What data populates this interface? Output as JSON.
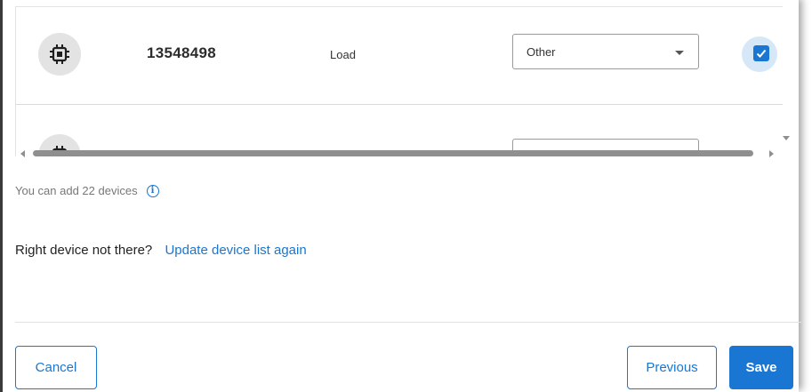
{
  "devices": [
    {
      "id": "13548498",
      "type": "Load",
      "category": "Other",
      "checked": true
    },
    {
      "id": "",
      "type": "",
      "category": "",
      "checked": false
    }
  ],
  "info": {
    "text": "You can add 22 devices",
    "icon": "info-icon"
  },
  "missing": {
    "text": "Right device not there?",
    "link": "Update device list again"
  },
  "footer": {
    "cancel_label": "Cancel",
    "previous_label": "Previous",
    "save_label": "Save"
  },
  "colors": {
    "accent": "#1976d2",
    "icon_bg": "#e3e3e3"
  }
}
